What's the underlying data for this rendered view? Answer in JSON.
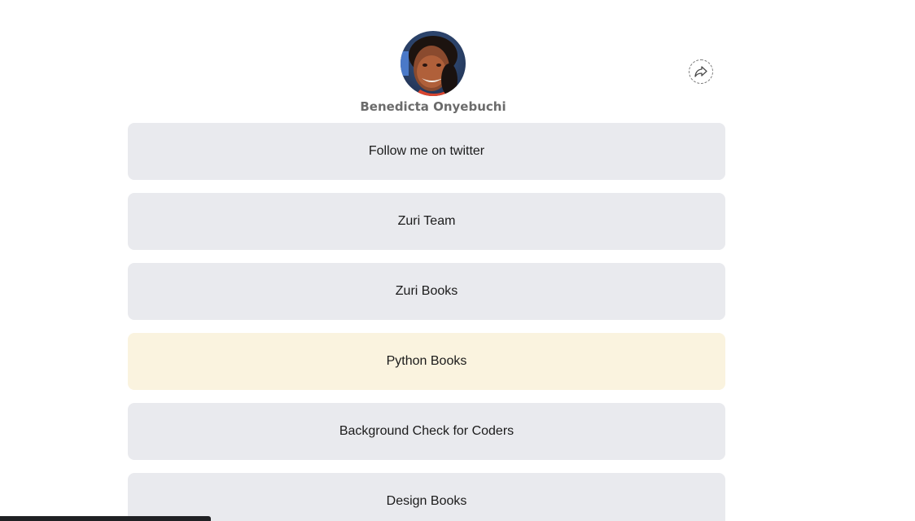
{
  "profile": {
    "name": "Benedicta Onyebuchi"
  },
  "links": [
    {
      "label": "Follow me on twitter"
    },
    {
      "label": "Zuri Team"
    },
    {
      "label": "Zuri Books"
    },
    {
      "label": "Python Books"
    },
    {
      "label": "Background Check for Coders"
    },
    {
      "label": "Design Books"
    }
  ],
  "icons": {
    "share": "share-icon",
    "avatar": "avatar"
  },
  "colors": {
    "link_background": "#e9eaee",
    "link_highlight_background": "#faf3df",
    "name_text": "#6b6b6b"
  }
}
